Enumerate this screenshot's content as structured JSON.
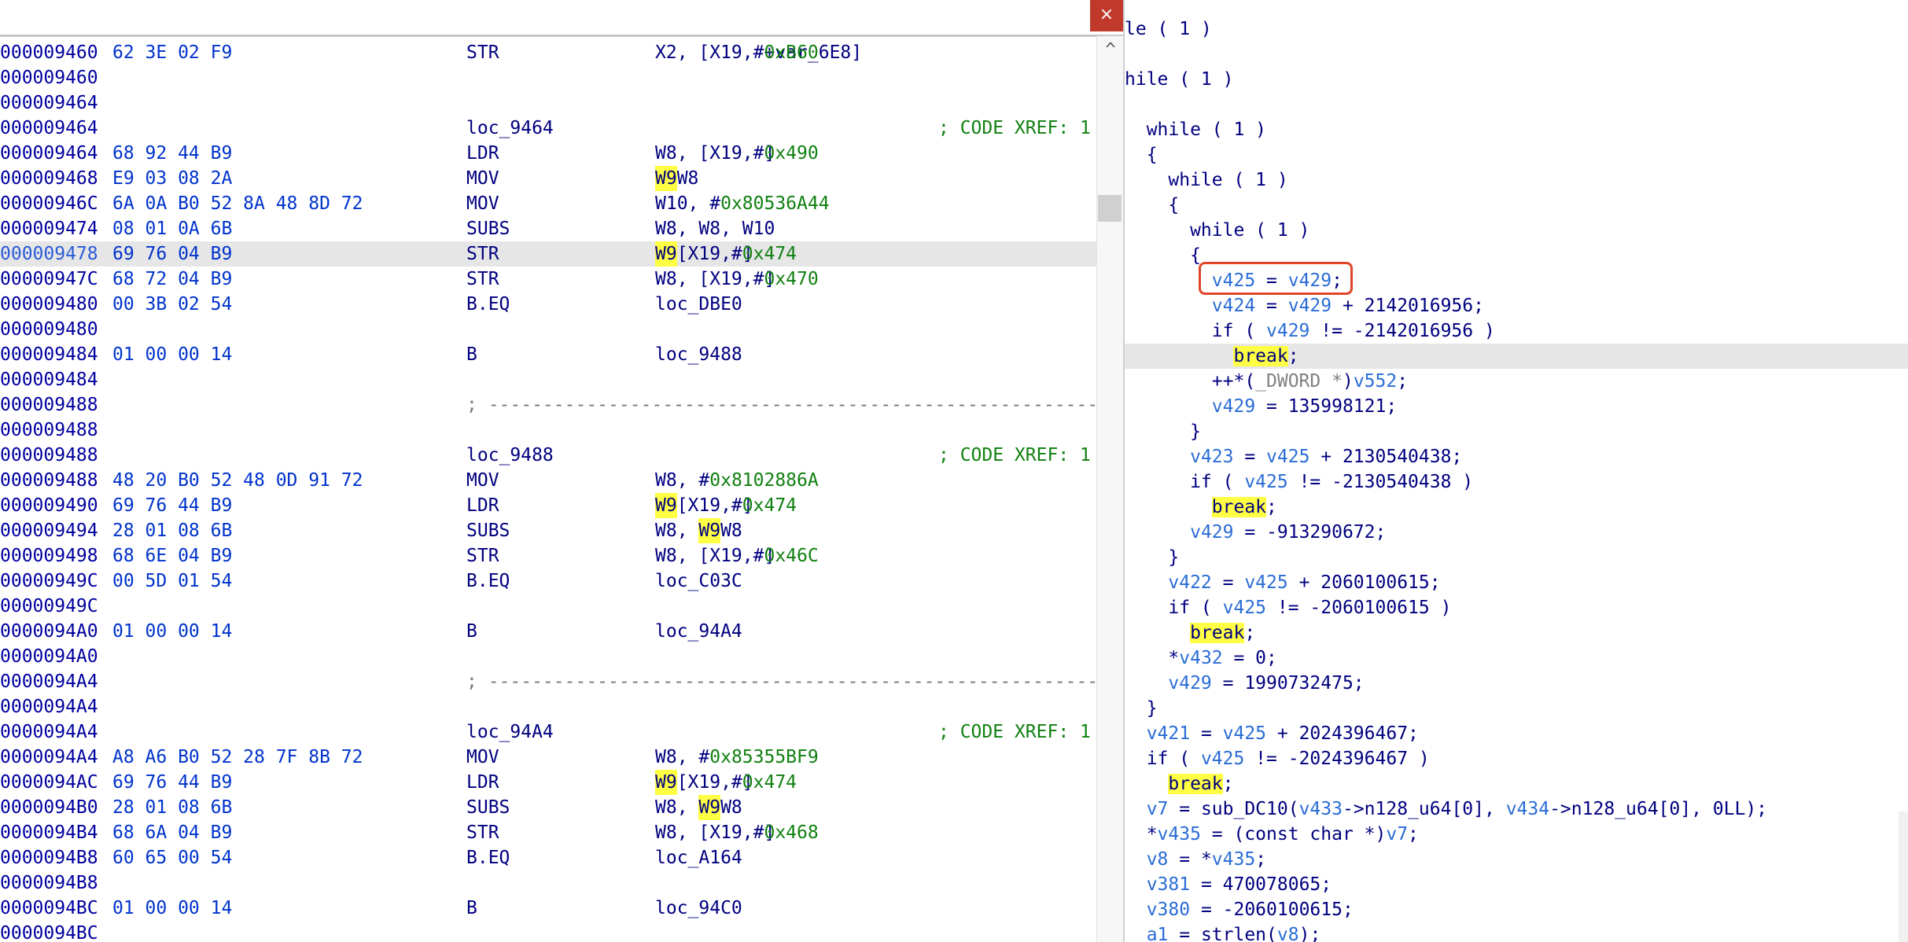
{
  "window": {
    "close_glyph": "×"
  },
  "disasm": {
    "scroll_up_glyph": "^",
    "lines": [
      {
        "addr": "000009460",
        "bytes": "62 3E 02 F9",
        "mn": "STR",
        "ops": "X2, [X19,#<n>0xB60</n>+var_6E8]"
      },
      {
        "addr": "000009460"
      },
      {
        "addr": "000009464"
      },
      {
        "addr": "000009464",
        "label": "loc_9464",
        "xref": "; CODE XREF: 1"
      },
      {
        "addr": "000009464",
        "bytes": "68 92 44 B9",
        "mn": "LDR",
        "ops": "W8, [X19,#<n>0x490</n>]"
      },
      {
        "addr": "000009468",
        "bytes": "E9 03 08 2A",
        "mn": "MOV",
        "ops": "<h>W9</h>, W8"
      },
      {
        "addr": "00000946C",
        "bytes": "6A 0A B0 52 8A 48 8D 72",
        "mn": "MOV",
        "ops": "W10, #<n>0x80536A44</n>"
      },
      {
        "addr": "000009474",
        "bytes": "08 01 0A 6B",
        "mn": "SUBS",
        "ops": "W8, W8, W10"
      },
      {
        "addr": "000009478",
        "bytes": "69 76 04 B9",
        "mn": "STR",
        "ops": "<c></c><h>W9</h>, [X19,#<n>0x474</n>]",
        "cur": true
      },
      {
        "addr": "00000947C",
        "bytes": "68 72 04 B9",
        "mn": "STR",
        "ops": "W8, [X19,#<n>0x470</n>]"
      },
      {
        "addr": "000009480",
        "bytes": "00 3B 02 54",
        "mn": "B.EQ",
        "ops": "loc_DBE0"
      },
      {
        "addr": "000009480"
      },
      {
        "addr": "000009484",
        "bytes": "01 00 00 14",
        "mn": "B",
        "ops": "loc_9488"
      },
      {
        "addr": "000009484"
      },
      {
        "addr": "000009488",
        "sep": "; ---------------------------------------------------------------"
      },
      {
        "addr": "000009488"
      },
      {
        "addr": "000009488",
        "label": "loc_9488",
        "xref": "; CODE XREF: 1"
      },
      {
        "addr": "000009488",
        "bytes": "48 20 B0 52 48 0D 91 72",
        "mn": "MOV",
        "ops": "W8, #<n>0x8102886A</n>"
      },
      {
        "addr": "000009490",
        "bytes": "69 76 44 B9",
        "mn": "LDR",
        "ops": "<h>W9</h>, [X19,#<n>0x474</n>]"
      },
      {
        "addr": "000009494",
        "bytes": "28 01 08 6B",
        "mn": "SUBS",
        "ops": "W8, <h>W9</h>, W8"
      },
      {
        "addr": "000009498",
        "bytes": "68 6E 04 B9",
        "mn": "STR",
        "ops": "W8, [X19,#<n>0x46C</n>]"
      },
      {
        "addr": "00000949C",
        "bytes": "00 5D 01 54",
        "mn": "B.EQ",
        "ops": "loc_C03C"
      },
      {
        "addr": "00000949C"
      },
      {
        "addr": "0000094A0",
        "bytes": "01 00 00 14",
        "mn": "B",
        "ops": "loc_94A4"
      },
      {
        "addr": "0000094A0"
      },
      {
        "addr": "0000094A4",
        "sep": "; ---------------------------------------------------------------"
      },
      {
        "addr": "0000094A4"
      },
      {
        "addr": "0000094A4",
        "label": "loc_94A4",
        "xref": "; CODE XREF: 1"
      },
      {
        "addr": "0000094A4",
        "bytes": "A8 A6 B0 52 28 7F 8B 72",
        "mn": "MOV",
        "ops": "W8, #<n>0x85355BF9</n>"
      },
      {
        "addr": "0000094AC",
        "bytes": "69 76 44 B9",
        "mn": "LDR",
        "ops": "<h>W9</h>, [X19,#<n>0x474</n>]"
      },
      {
        "addr": "0000094B0",
        "bytes": "28 01 08 6B",
        "mn": "SUBS",
        "ops": "W8, <h>W9</h>, W8"
      },
      {
        "addr": "0000094B4",
        "bytes": "68 6A 04 B9",
        "mn": "STR",
        "ops": "W8, [X19,#<n>0x468</n>]"
      },
      {
        "addr": "0000094B8",
        "bytes": "60 65 00 54",
        "mn": "B.EQ",
        "ops": "loc_A164"
      },
      {
        "addr": "0000094B8"
      },
      {
        "addr": "0000094BC",
        "bytes": "01 00 00 14",
        "mn": "B",
        "ops": "loc_94C0"
      },
      {
        "addr": "0000094BC"
      }
    ]
  },
  "pseudo": {
    "lines": [
      {
        "t": "le ( 1 )"
      },
      {
        "t": ""
      },
      {
        "t": "hile ( 1 )"
      },
      {
        "t": ""
      },
      {
        "t": "  while ( 1 )"
      },
      {
        "t": "  {"
      },
      {
        "t": "    while ( 1 )"
      },
      {
        "t": "    {"
      },
      {
        "t": "      while ( 1 )"
      },
      {
        "t": "      {"
      },
      {
        "t": "        <v>v425</v> = <v>v429</v>;"
      },
      {
        "t": "        <v>v424</v> = <v>v429</v> + 2142016956;"
      },
      {
        "t": "        if ( <v>v429</v> != -2142016956 )"
      },
      {
        "t": "          <h>break</h>;",
        "cur": true
      },
      {
        "t": "        ++*(<g>_DWORD *</g>)<v>v552</v>;"
      },
      {
        "t": "        <v>v429</v> = 135998121;"
      },
      {
        "t": "      }"
      },
      {
        "t": "      <v>v423</v> = <v>v425</v> + 2130540438;"
      },
      {
        "t": "      if ( <v>v425</v> != -2130540438 )"
      },
      {
        "t": "        <h>break</h>;"
      },
      {
        "t": "      <v>v429</v> = -913290672;"
      },
      {
        "t": "    }"
      },
      {
        "t": "    <v>v422</v> = <v>v425</v> + 2060100615;"
      },
      {
        "t": "    if ( <v>v425</v> != -2060100615 )"
      },
      {
        "t": "      <h>break</h>;"
      },
      {
        "t": "    *<v>v432</v> = 0;"
      },
      {
        "t": "    <v>v429</v> = 1990732475;"
      },
      {
        "t": "  }"
      },
      {
        "t": "  <v>v421</v> = <v>v425</v> + 2024396467;"
      },
      {
        "t": "  if ( <v>v425</v> != -2024396467 )"
      },
      {
        "t": "    <h>break</h>;"
      },
      {
        "t": "  <v>v7</v> = sub_DC10(<v>v433</v>->n128_u64[0], <v>v434</v>->n128_u64[0], 0LL);"
      },
      {
        "t": "  *<v>v435</v> = (const char *)<v>v7</v>;"
      },
      {
        "t": "  <v>v8</v> = *<v>v435</v>;"
      },
      {
        "t": "  <v>v381</v> = 470078065;"
      },
      {
        "t": "  <v>v380</v> = -2060100615;"
      },
      {
        "t": "  <v>a1</v> = strlen(<v>v8</v>);"
      }
    ]
  }
}
